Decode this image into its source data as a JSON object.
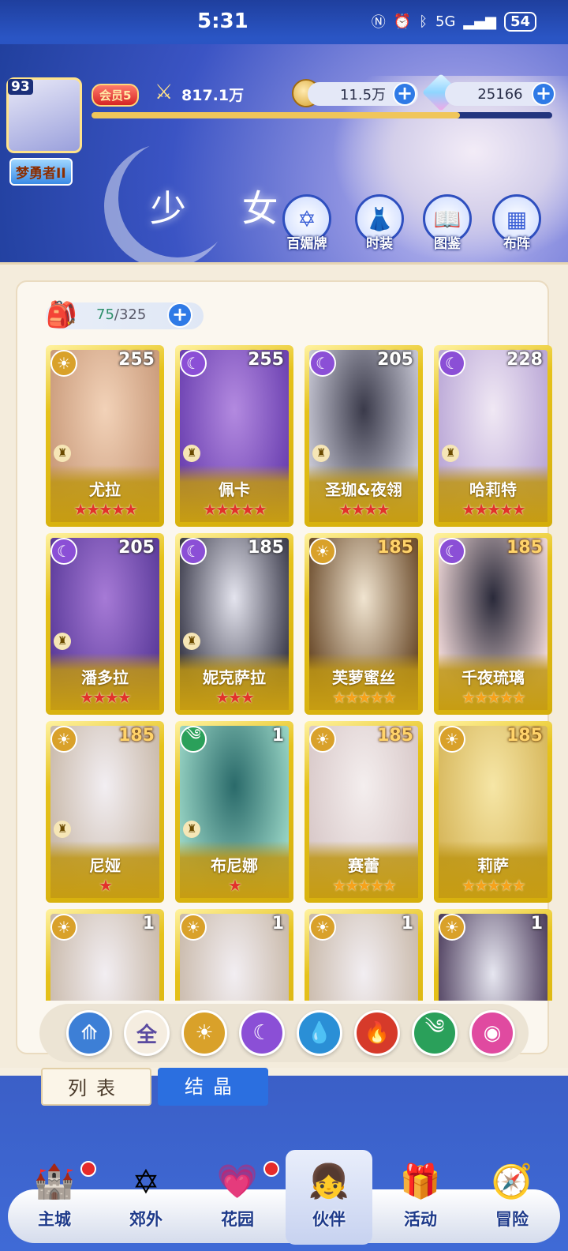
{
  "status": {
    "time": "5:31",
    "battery": "54",
    "network": "5G"
  },
  "player": {
    "level": "93",
    "rank": "梦勇者II",
    "vip": "会员5",
    "power": "817.1万",
    "gold": "11.5万",
    "gems": "25166"
  },
  "header": {
    "title": "少 女",
    "menu": [
      {
        "label": "百媚牌",
        "icon": "star-card-icon"
      },
      {
        "label": "时装",
        "icon": "outfit-icon"
      },
      {
        "label": "图鉴",
        "icon": "book-icon"
      },
      {
        "label": "布阵",
        "icon": "formation-grid-icon"
      }
    ]
  },
  "roster": {
    "capacity_current": "75",
    "capacity_total": "/325",
    "cards": [
      {
        "name": "尤拉",
        "level": "255",
        "element": "sun",
        "stars": "★★★★★",
        "star_color": "red"
      },
      {
        "name": "佩卡",
        "level": "255",
        "element": "moon",
        "stars": "★★★★★",
        "star_color": "red"
      },
      {
        "name": "圣珈&夜翎",
        "level": "205",
        "element": "moon",
        "stars": "★★★★",
        "star_color": "red"
      },
      {
        "name": "哈莉特",
        "level": "228",
        "element": "moon",
        "stars": "★★★★★",
        "star_color": "red"
      },
      {
        "name": "潘多拉",
        "level": "205",
        "element": "moon",
        "stars": "★★★★",
        "star_color": "red"
      },
      {
        "name": "妮克萨拉",
        "level": "185",
        "element": "moon",
        "stars": "★★★",
        "star_color": "red"
      },
      {
        "name": "芙萝蜜丝",
        "level": "185",
        "element": "sun",
        "stars": "★★★★★",
        "star_color": "gold"
      },
      {
        "name": "千夜琉璃",
        "level": "185",
        "element": "moon",
        "stars": "★★★★★",
        "star_color": "gold"
      },
      {
        "name": "尼娅",
        "level": "185",
        "element": "sun",
        "stars": "★",
        "star_color": "red"
      },
      {
        "name": "布尼娜",
        "level": "1",
        "element": "wind",
        "stars": "★",
        "star_color": "red"
      },
      {
        "name": "赛蕾",
        "level": "185",
        "element": "sun",
        "stars": "★★★★★",
        "star_color": "gold"
      },
      {
        "name": "莉萨",
        "level": "185",
        "element": "sun",
        "stars": "★★★★★",
        "star_color": "gold"
      },
      {
        "name": "",
        "level": "1",
        "element": "sun",
        "stars": "",
        "star_color": "red"
      },
      {
        "name": "",
        "level": "1",
        "element": "sun",
        "stars": "",
        "star_color": "red"
      },
      {
        "name": "",
        "level": "1",
        "element": "sun",
        "stars": "",
        "star_color": "red"
      },
      {
        "name": "",
        "level": "1",
        "element": "sun",
        "stars": "",
        "star_color": "red"
      }
    ]
  },
  "filters": [
    {
      "label": "",
      "icon": "wings-icon",
      "color": "#3d7fd6"
    },
    {
      "label": "全",
      "icon": "all-icon",
      "color": "#f5ede0"
    },
    {
      "label": "",
      "icon": "sun-icon",
      "color": "#d9a12a"
    },
    {
      "label": "",
      "icon": "moon-icon",
      "color": "#8b4fd6"
    },
    {
      "label": "",
      "icon": "water-drop-icon",
      "color": "#2a8fd6"
    },
    {
      "label": "",
      "icon": "fire-icon",
      "color": "#d63a2a"
    },
    {
      "label": "",
      "icon": "wind-icon",
      "color": "#2aa05a"
    },
    {
      "label": "",
      "icon": "planet-icon",
      "color": "#e04aa0"
    }
  ],
  "tabs": {
    "list": "列表",
    "crystal": "结晶"
  },
  "nav": [
    {
      "label": "主城",
      "badge": true
    },
    {
      "label": "郊外",
      "badge": false
    },
    {
      "label": "花园",
      "badge": true
    },
    {
      "label": "伙伴",
      "badge": false
    },
    {
      "label": "活动",
      "badge": false
    },
    {
      "label": "冒险",
      "badge": false
    }
  ]
}
